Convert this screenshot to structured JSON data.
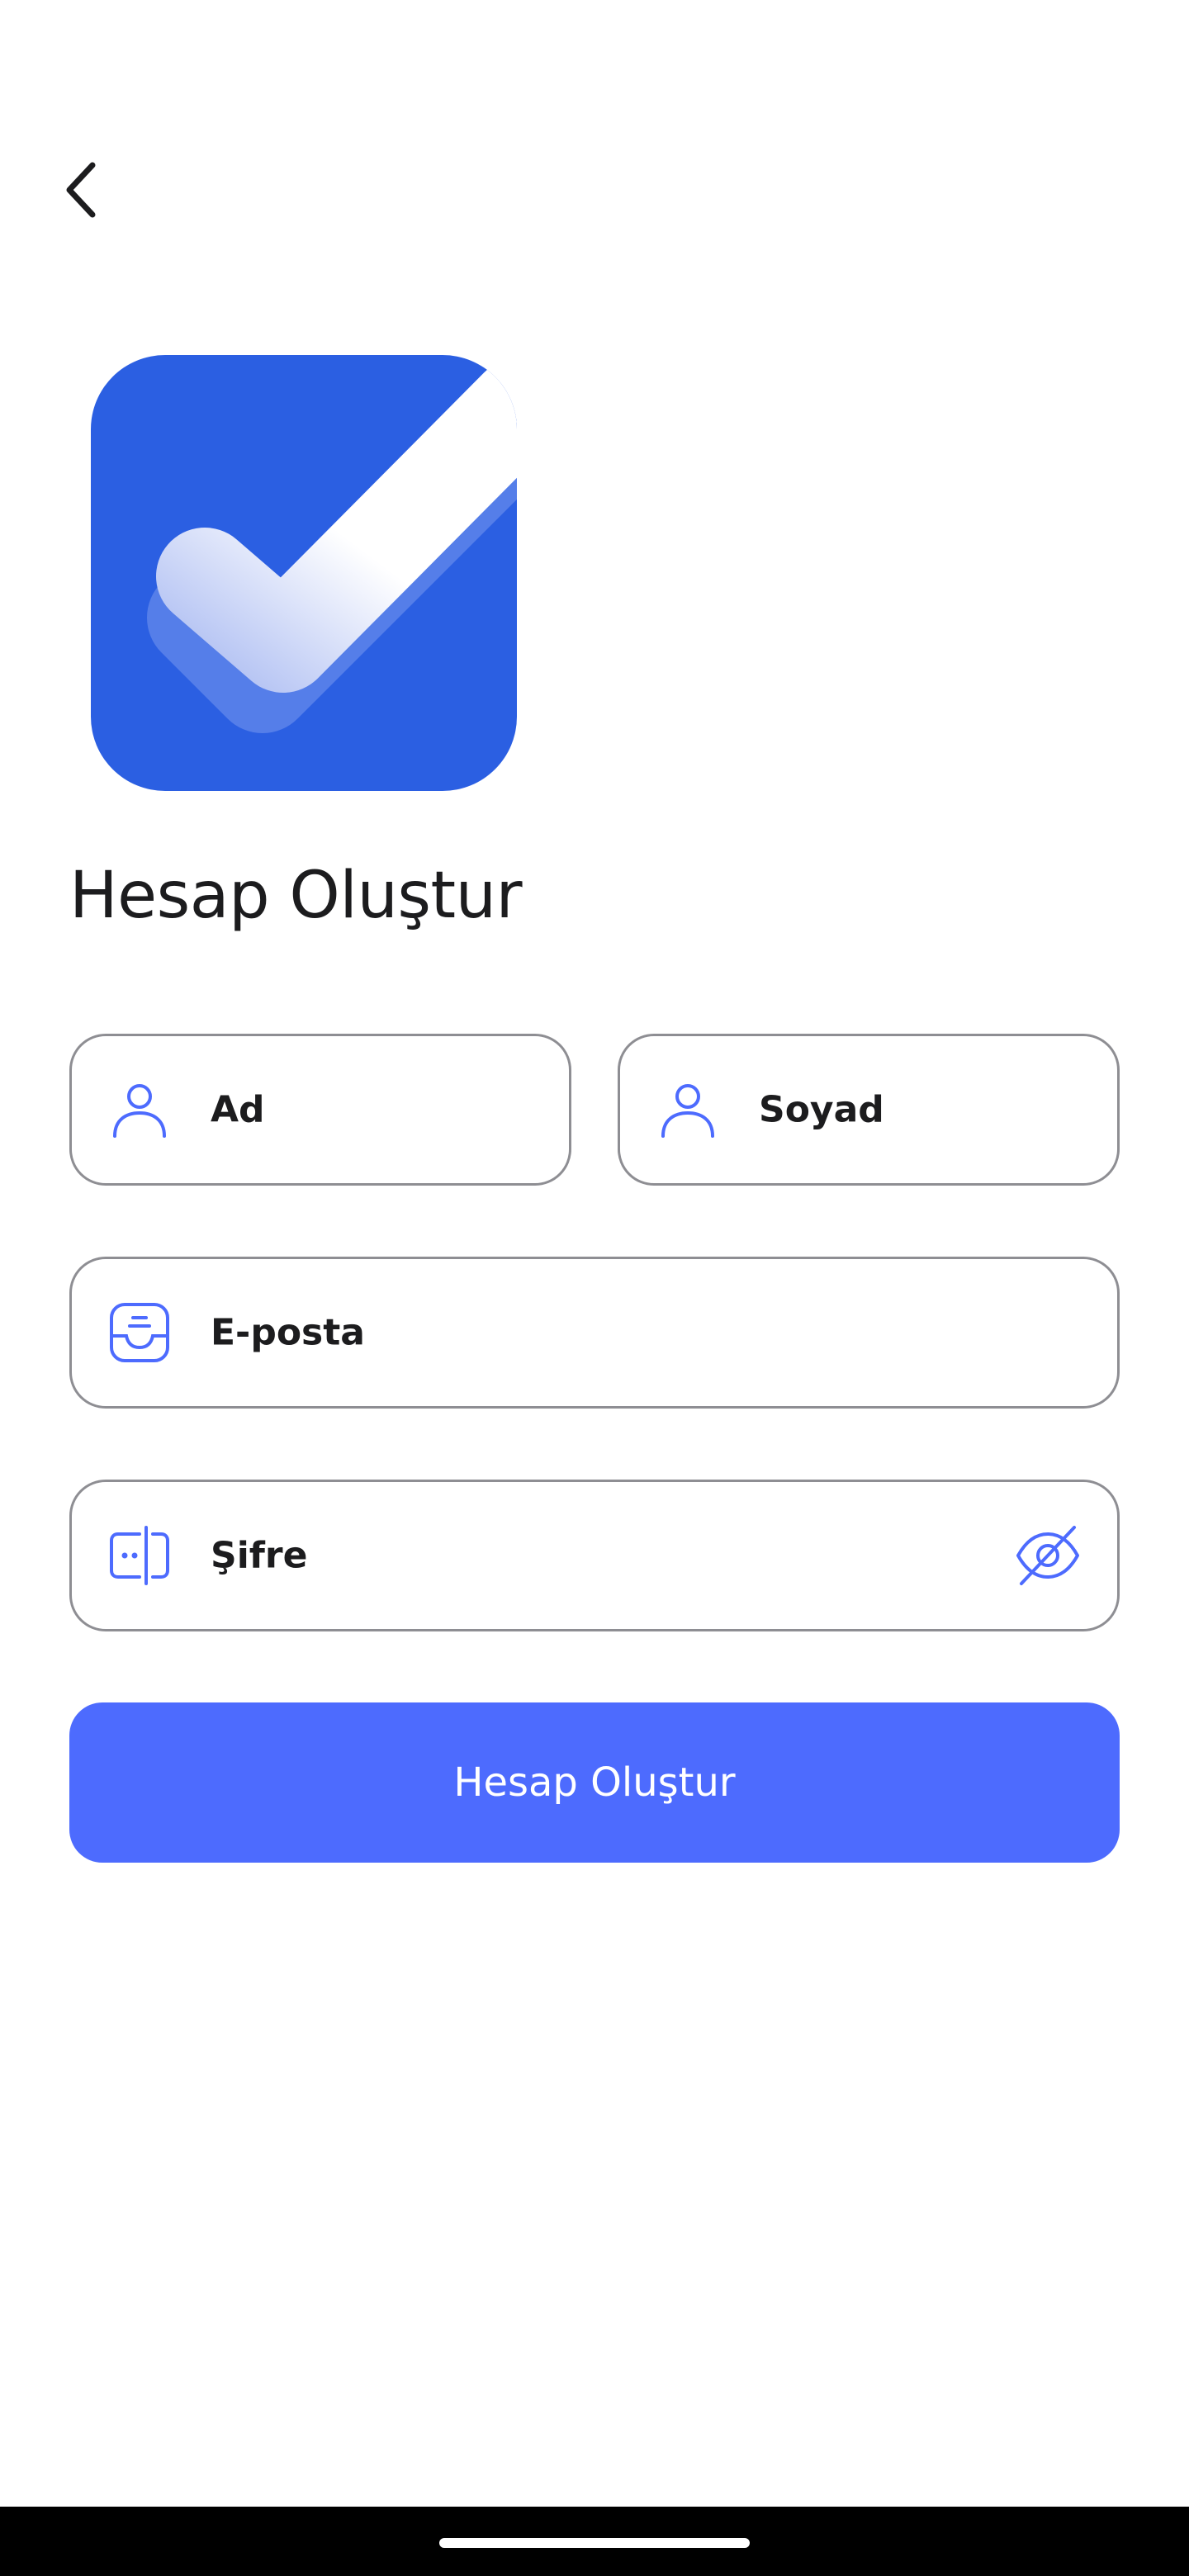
{
  "header": {
    "back_icon": "chevron-left-icon"
  },
  "logo": {
    "icon": "checkmark-app-logo",
    "background_color": "#2b5fe2"
  },
  "title": "Hesap Oluştur",
  "form": {
    "first_name": {
      "label": "Ad",
      "icon": "user-icon"
    },
    "last_name": {
      "label": "Soyad",
      "icon": "user-icon"
    },
    "email": {
      "label": "E-posta",
      "icon": "inbox-icon"
    },
    "password": {
      "label": "Şifre",
      "icon": "password-icon",
      "visibility_icon": "eye-off-icon"
    },
    "submit_label": "Hesap Oluştur"
  },
  "colors": {
    "accent": "#4d6bfe",
    "icon": "#4d6bfe",
    "field_border": "#8e8e93",
    "text": "#1c1c1e"
  }
}
